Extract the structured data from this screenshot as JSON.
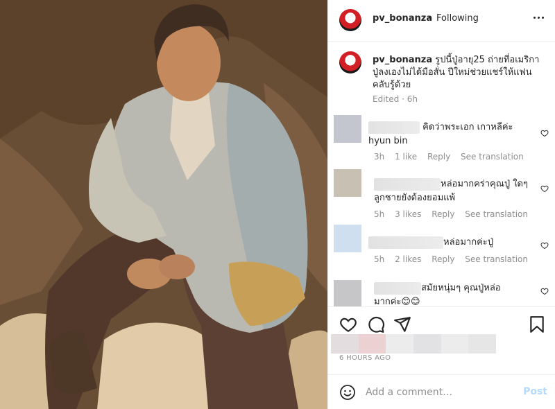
{
  "post": {
    "author": "pv_bonanza",
    "separator": "•",
    "follow_status": "Following",
    "more_icon": "more-horizontal-icon",
    "photo_alt": "vintage-photo"
  },
  "caption": {
    "author": "pv_bonanza",
    "text": "รูปนี้ปู่อายุ25 ถ่ายที่อเมริกา ปู่ลงเองไม่ได้มือสั่น ปีใหม่ช่วยแชร์ให้แฟนคลับรู้ด้วย",
    "edited": "Edited",
    "dot": "·",
    "age": "6h"
  },
  "comments": [
    {
      "text_lines": [
        "คิดว่าพระเอก เกาหลีค่ะ",
        "hyun bin"
      ],
      "age": "3h",
      "likes": "1 like",
      "reply": "Reply",
      "translate": "See translation",
      "avatar_color": "#c4c6cf"
    },
    {
      "text_lines": [
        "หล่อมากคร่าคุณปู่ ใดๆ",
        "ลูกชายยังต้องยอมแพ้"
      ],
      "age": "5h",
      "likes": "3 likes",
      "reply": "Reply",
      "translate": "See translation",
      "avatar_color": "#c9c0b4"
    },
    {
      "text_lines": [
        "หล่อมากค่ะปู่"
      ],
      "age": "5h",
      "likes": "2 likes",
      "reply": "Reply",
      "translate": "See translation",
      "avatar_color": "#cfdff0"
    },
    {
      "text_lines": [
        "สมัยหนุ่มๆ คุณปู่หล่อ",
        "มากค่ะ😊😊"
      ],
      "avatar_color": "#c6c6c8"
    }
  ],
  "actions": {
    "like_icon": "heart-icon",
    "comment_icon": "comment-icon",
    "share_icon": "share-icon",
    "save_icon": "bookmark-icon",
    "timestamp": "6 HOURS AGO"
  },
  "compose": {
    "emoji_icon": "emoji-icon",
    "placeholder": "Add a comment…",
    "post_label": "Post"
  },
  "colors": {
    "text": "#262626",
    "secondary": "#8e8e8e",
    "post_disabled": "#b3dbff",
    "border": "#efefef"
  }
}
